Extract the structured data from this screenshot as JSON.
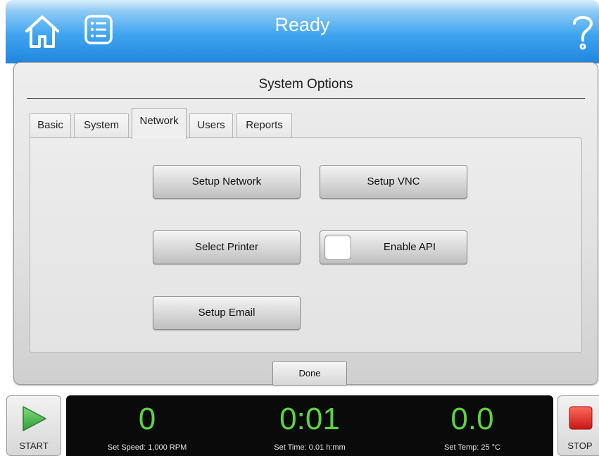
{
  "header": {
    "title": "Ready",
    "home_icon": "home-icon",
    "menu_icon": "list-menu-icon",
    "help_icon": "question-mark-icon"
  },
  "panel": {
    "title": "System Options",
    "tabs": [
      {
        "label": "Basic",
        "active": false
      },
      {
        "label": "System",
        "active": false
      },
      {
        "label": "Network",
        "active": true
      },
      {
        "label": "Users",
        "active": false
      },
      {
        "label": "Reports",
        "active": false
      }
    ],
    "buttons": {
      "setup_network": "Setup Network",
      "setup_vnc": "Setup VNC",
      "select_printer": "Select Printer",
      "enable_api": "Enable API",
      "setup_email": "Setup Email"
    },
    "enable_api_checked": false,
    "done_label": "Done"
  },
  "footer": {
    "start_label": "START",
    "stop_label": "STOP",
    "speed": {
      "value": "0",
      "setpoint": "Set Speed: 1,000 RPM"
    },
    "time": {
      "value": "0:01",
      "setpoint": "Set Time: 0.01 h:mm"
    },
    "temp": {
      "value": "0.0",
      "setpoint": "Set Temp: 25 °C"
    }
  },
  "colors": {
    "header_blue": "#2d96e8",
    "readout_green": "#5cd53f",
    "start_green": "#3aa844",
    "stop_red": "#e02020"
  }
}
